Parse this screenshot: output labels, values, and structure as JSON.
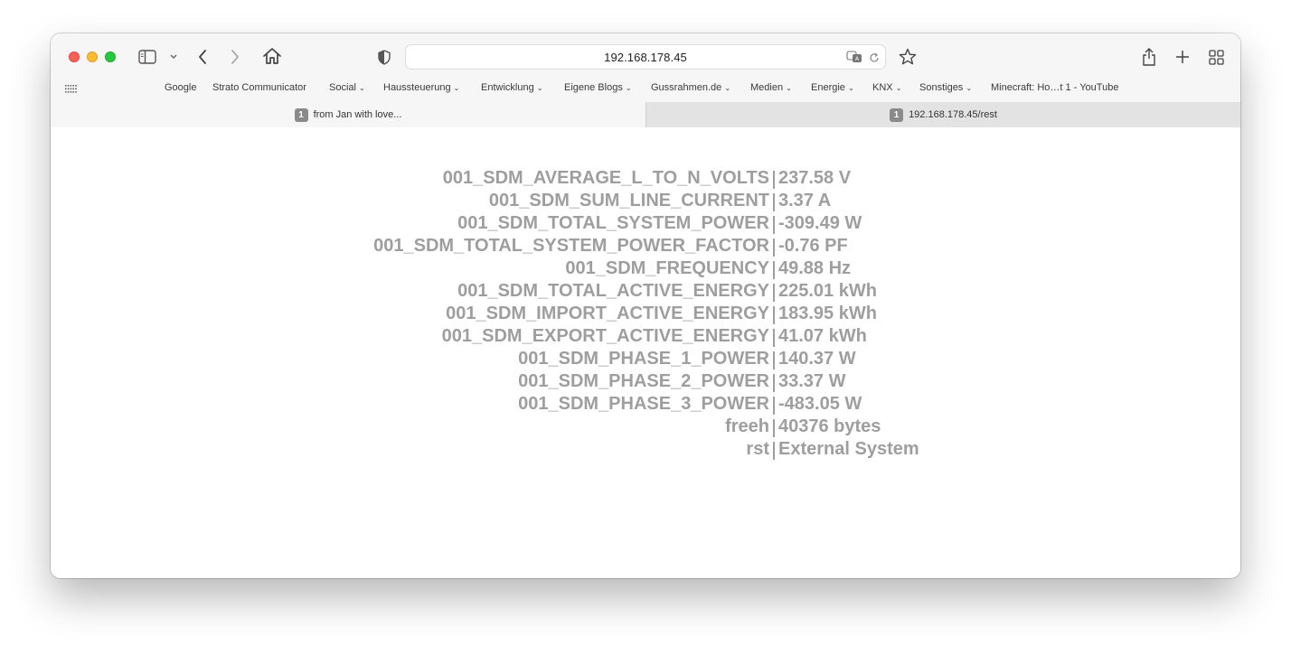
{
  "browser": {
    "address": "192.168.178.45",
    "bookmarks": [
      {
        "label": "Google",
        "dropdown": false
      },
      {
        "label": "Strato Communicator",
        "dropdown": false
      },
      {
        "label": "Social",
        "dropdown": true
      },
      {
        "label": "Haussteuerung",
        "dropdown": true
      },
      {
        "label": "Entwicklung",
        "dropdown": true
      },
      {
        "label": "Eigene Blogs",
        "dropdown": true
      },
      {
        "label": "Gussrahmen.de",
        "dropdown": true
      },
      {
        "label": "Medien",
        "dropdown": true
      },
      {
        "label": "Energie",
        "dropdown": true
      },
      {
        "label": "KNX",
        "dropdown": true
      },
      {
        "label": "Sonstiges",
        "dropdown": true
      },
      {
        "label": "Minecraft: Ho…t 1 - YouTube",
        "dropdown": false
      }
    ],
    "tabs": [
      {
        "badge": "1",
        "title": "from Jan with love...",
        "active": false
      },
      {
        "badge": "1",
        "title": "192.168.178.45/rest",
        "active": true
      }
    ]
  },
  "page": {
    "rows": [
      {
        "key": "001_SDM_AVERAGE_L_TO_N_VOLTS",
        "value": "237.58 V"
      },
      {
        "key": "001_SDM_SUM_LINE_CURRENT",
        "value": "3.37 A"
      },
      {
        "key": "001_SDM_TOTAL_SYSTEM_POWER",
        "value": "-309.49 W"
      },
      {
        "key": "001_SDM_TOTAL_SYSTEM_POWER_FACTOR",
        "value": "-0.76 PF"
      },
      {
        "key": "001_SDM_FREQUENCY",
        "value": "49.88 Hz"
      },
      {
        "key": "001_SDM_TOTAL_ACTIVE_ENERGY",
        "value": "225.01 kWh"
      },
      {
        "key": "001_SDM_IMPORT_ACTIVE_ENERGY",
        "value": "183.95 kWh"
      },
      {
        "key": "001_SDM_EXPORT_ACTIVE_ENERGY",
        "value": "41.07 kWh"
      },
      {
        "key": "001_SDM_PHASE_1_POWER",
        "value": "140.37 W"
      },
      {
        "key": "001_SDM_PHASE_2_POWER",
        "value": "33.37 W"
      },
      {
        "key": "001_SDM_PHASE_3_POWER",
        "value": "-483.05 W"
      },
      {
        "key": "freeh",
        "value": "40376 bytes"
      },
      {
        "key": "rst",
        "value": "External System"
      }
    ]
  },
  "colors": {
    "text": "#9e9e9e",
    "close": "#fe5f57",
    "minimize": "#febc2e",
    "maximize": "#28c840"
  }
}
